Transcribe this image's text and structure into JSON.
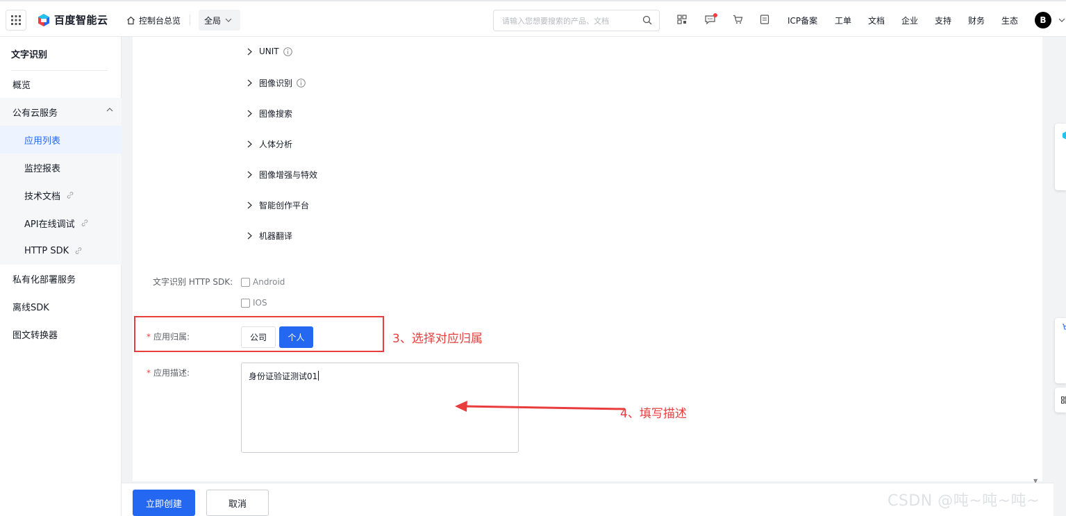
{
  "topbar": {
    "logo_text": "百度智能云",
    "home_label": "控制台总览",
    "region_label": "全局",
    "search_placeholder": "请输入您想要搜索的产品、文档",
    "nav": [
      "ICP备案",
      "工单",
      "文档",
      "企业",
      "支持",
      "财务",
      "生态"
    ],
    "avatar_initial": "B"
  },
  "sidebar": {
    "title": "文字识别",
    "items": [
      {
        "label": "概览"
      },
      {
        "label": "公有云服务"
      },
      {
        "label": "应用列表"
      },
      {
        "label": "监控报表"
      },
      {
        "label": "技术文档"
      },
      {
        "label": "API在线调试"
      },
      {
        "label": "HTTP SDK"
      },
      {
        "label": "私有化部署服务"
      },
      {
        "label": "离线SDK"
      },
      {
        "label": "图文转换器"
      }
    ]
  },
  "categories": [
    "UNIT",
    "图像识别",
    "图像搜索",
    "人体分析",
    "图像增强与特效",
    "智能创作平台",
    "机器翻译"
  ],
  "form": {
    "sdk_label": "文字识别 HTTP SDK:",
    "sdk_options": [
      "Android",
      "IOS"
    ],
    "ownership_label": "应用归属:",
    "ownership_options": [
      "公司",
      "个人"
    ],
    "description_label": "应用描述:",
    "description_value": "身份证验证测试01"
  },
  "annotations": {
    "step3": "3、选择对应归属",
    "step4": "4、填写描述"
  },
  "actions": {
    "create_label": "立即创建",
    "cancel_label": "取消"
  },
  "watermark": "CSDN @吨~吨~吨~",
  "colors": {
    "primary": "#2468f2",
    "annotation_red": "#e93c3c"
  }
}
